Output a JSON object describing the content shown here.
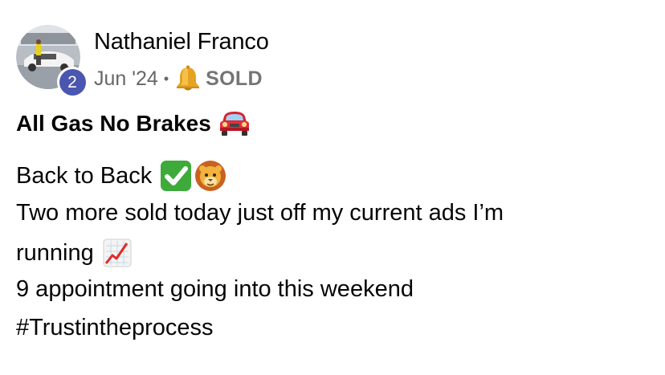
{
  "author": {
    "name": "Nathaniel Franco",
    "avatar_badge_count": "2"
  },
  "meta": {
    "date": "Jun '24",
    "separator": "•",
    "tag_icon": "bell-icon",
    "tag_label": "SOLD"
  },
  "post": {
    "title": "All Gas No Brakes",
    "title_emoji": "car-emoji",
    "line1": "Back to Back",
    "line1_emojis": [
      "check-mark-emoji",
      "lion-emoji"
    ],
    "line2": "Two more sold today just off my current ads I’m",
    "line3": "running",
    "line3_emoji": "chart-increasing-emoji",
    "line4": "9 appointment going into this weekend",
    "line5": "#Trustintheprocess"
  },
  "colors": {
    "badge": "#4a56b0",
    "meta_text": "#65676b",
    "check_green": "#3daa3a",
    "car_red": "#d8202e",
    "bell_gold": "#e5a322"
  }
}
